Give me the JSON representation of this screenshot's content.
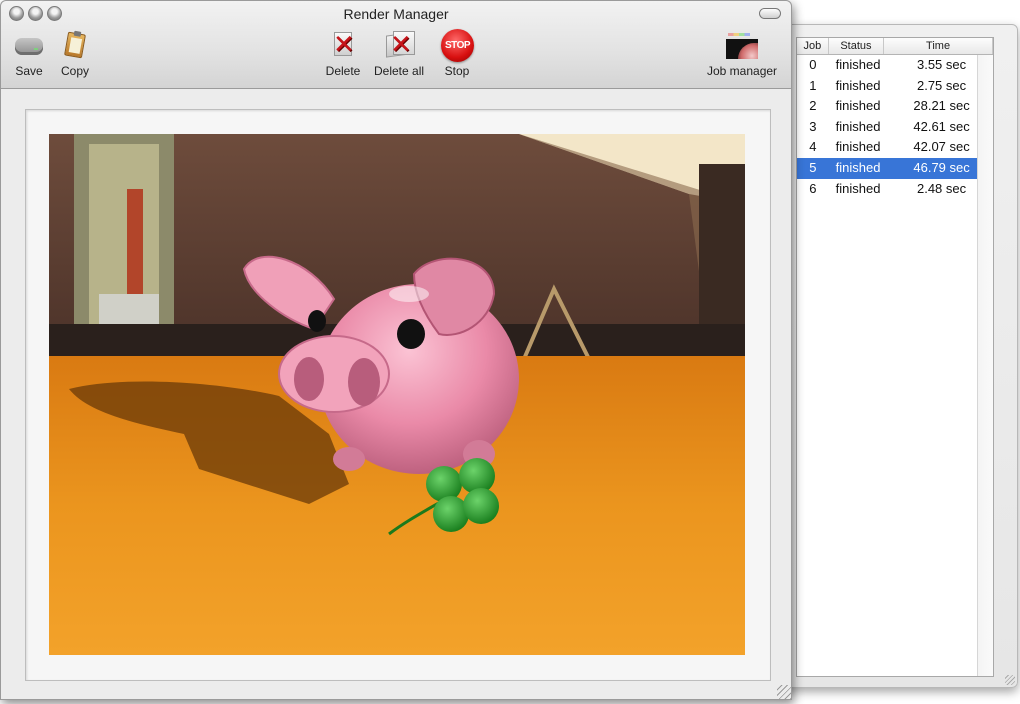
{
  "main_window": {
    "title": "Render Manager",
    "toolbar": [
      {
        "id": "save",
        "label": "Save",
        "icon": "disk-icon"
      },
      {
        "id": "copy",
        "label": "Copy",
        "icon": "clipboard-icon"
      },
      {
        "id": "delete",
        "label": "Delete",
        "icon": "delete-icon"
      },
      {
        "id": "delete_all",
        "label": "Delete all",
        "icon": "delete-all-icon"
      },
      {
        "id": "stop",
        "label": "Stop",
        "icon": "stop-sign-icon",
        "icon_text": "STOP"
      },
      {
        "id": "job_manager",
        "label": "Job manager",
        "icon": "job-manager-icon"
      }
    ],
    "render_preview": {
      "subject": "pink piggy bank with four-leaf clover on wooden table",
      "colors": {
        "table": "#e8901c",
        "pig": "#e98aa6",
        "clover": "#2e9a2e",
        "wall": "#6b4a3a"
      }
    }
  },
  "job_manager": {
    "columns": [
      "Job",
      "Status",
      "Time"
    ],
    "rows": [
      {
        "job": "0",
        "status": "finished",
        "time": "3.55 sec"
      },
      {
        "job": "1",
        "status": "finished",
        "time": "2.75 sec"
      },
      {
        "job": "2",
        "status": "finished",
        "time": "28.21 sec"
      },
      {
        "job": "3",
        "status": "finished",
        "time": "42.61 sec"
      },
      {
        "job": "4",
        "status": "finished",
        "time": "42.07 sec"
      },
      {
        "job": "5",
        "status": "finished",
        "time": "46.79 sec",
        "selected": true
      },
      {
        "job": "6",
        "status": "finished",
        "time": "2.48 sec"
      }
    ],
    "selection_color": "#3875d7"
  }
}
